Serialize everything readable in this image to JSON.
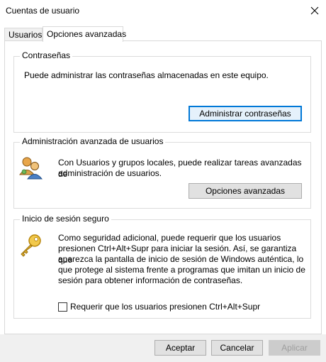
{
  "window": {
    "title": "Cuentas de usuario"
  },
  "tabs": [
    {
      "label": "Usuarios",
      "active": false
    },
    {
      "label": "Opciones avanzadas",
      "active": true
    }
  ],
  "passwords": {
    "title": "Contraseñas",
    "text": "Puede administrar las contraseñas almacenadas en este equipo.",
    "button": "Administrar contraseñas"
  },
  "advanced_users": {
    "title": "Administración avanzada de usuarios",
    "text_line1": "Con Usuarios y grupos locales, puede realizar tareas avanzadas de",
    "text_line2": "administración de usuarios.",
    "button": "Opciones avanzadas",
    "icon": "users-group-icon"
  },
  "secure_logon": {
    "title": "Inicio de sesión seguro",
    "lines": [
      "Como seguridad adicional, puede requerir que los usuarios",
      "presionen Ctrl+Alt+Supr para iniciar la sesión. Así, se garantiza que",
      "aparezca la pantalla de inicio de sesión de Windows auténtica, lo",
      "que protege al sistema frente a programas que imitan un inicio de",
      "sesión para obtener información de contraseñas."
    ],
    "checkbox_label": "Requerir que los usuarios presionen Ctrl+Alt+Supr",
    "checkbox_checked": false,
    "icon": "key-icon"
  },
  "buttons": {
    "accept": "Aceptar",
    "cancel": "Cancelar",
    "apply": "Aplicar"
  },
  "colors": {
    "focus_border": "#0078d7",
    "button_face": "#e1e1e1",
    "footer": "#f0f0f0"
  }
}
